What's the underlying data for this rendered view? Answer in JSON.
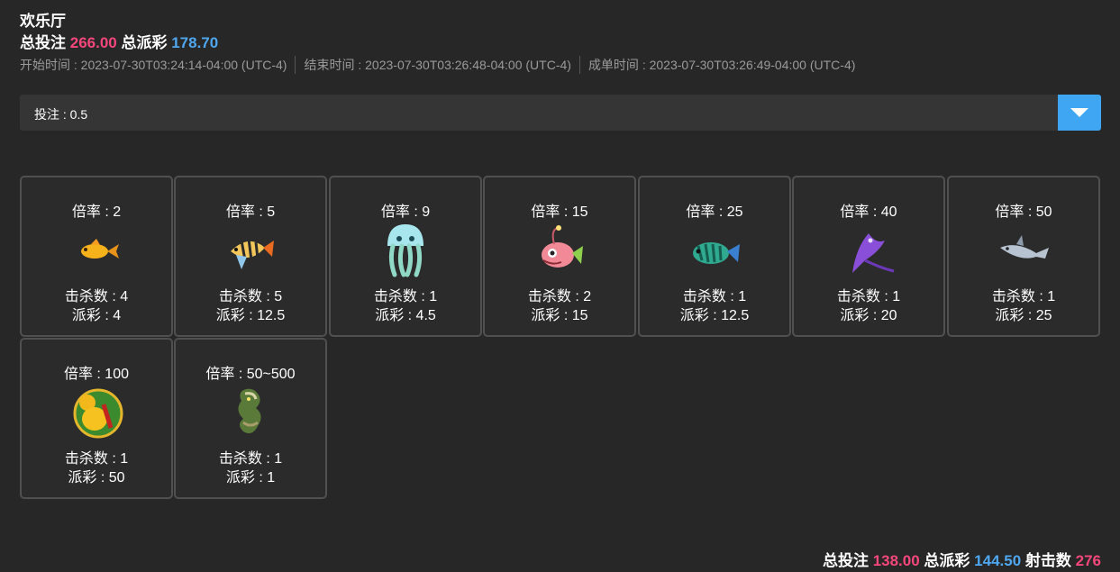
{
  "header": {
    "title": "欢乐厅",
    "total_bet_label": "总投注",
    "total_bet_value": "266.00",
    "total_payout_label": "总派彩",
    "total_payout_value": "178.70",
    "start_time": "开始时间 : 2023-07-30T03:24:14-04:00 (UTC-4)",
    "end_time": "结束时间 : 2023-07-30T03:26:48-04:00 (UTC-4)",
    "deal_time": "成单时间 : 2023-07-30T03:26:49-04:00 (UTC-4)"
  },
  "bet_selector": {
    "label": "投注 : 0.5",
    "icon": "chevron-down-icon",
    "accent_color": "#3fa6f3"
  },
  "cards": [
    {
      "rate": "倍率 : 2",
      "icon": "goldfish-icon",
      "kills": "击杀数 : 4",
      "payout": "派彩 : 4"
    },
    {
      "rate": "倍率 : 5",
      "icon": "angelfish-icon",
      "kills": "击杀数 : 5",
      "payout": "派彩 : 12.5"
    },
    {
      "rate": "倍率 : 9",
      "icon": "jellyfish-icon",
      "kills": "击杀数 : 1",
      "payout": "派彩 : 4.5"
    },
    {
      "rate": "倍率 : 15",
      "icon": "anglerfish-icon",
      "kills": "击杀数 : 2",
      "payout": "派彩 : 15"
    },
    {
      "rate": "倍率 : 25",
      "icon": "lionfish-icon",
      "kills": "击杀数 : 1",
      "payout": "派彩 : 12.5"
    },
    {
      "rate": "倍率 : 40",
      "icon": "manta-ray-icon",
      "kills": "击杀数 : 1",
      "payout": "派彩 : 20"
    },
    {
      "rate": "倍率 : 50",
      "icon": "shark-icon",
      "kills": "击杀数 : 1",
      "payout": "派彩 : 25"
    },
    {
      "rate": "倍率 : 100",
      "icon": "golden-gourd-icon",
      "kills": "击杀数 : 1",
      "payout": "派彩 : 50"
    },
    {
      "rate": "倍率 : 50~500",
      "icon": "dragon-icon",
      "kills": "击杀数 : 1",
      "payout": "派彩 : 1"
    }
  ],
  "footer": {
    "total_bet_label": "总投注",
    "total_bet_value": "138.00",
    "total_payout_label": "总派彩",
    "total_payout_value": "144.50",
    "shots_label": "射击数",
    "shots_value": "276"
  },
  "colors": {
    "background": "#272727",
    "bet_value": "#f5477c",
    "payout_value": "#4fa7ef",
    "card_border": "#505050"
  }
}
